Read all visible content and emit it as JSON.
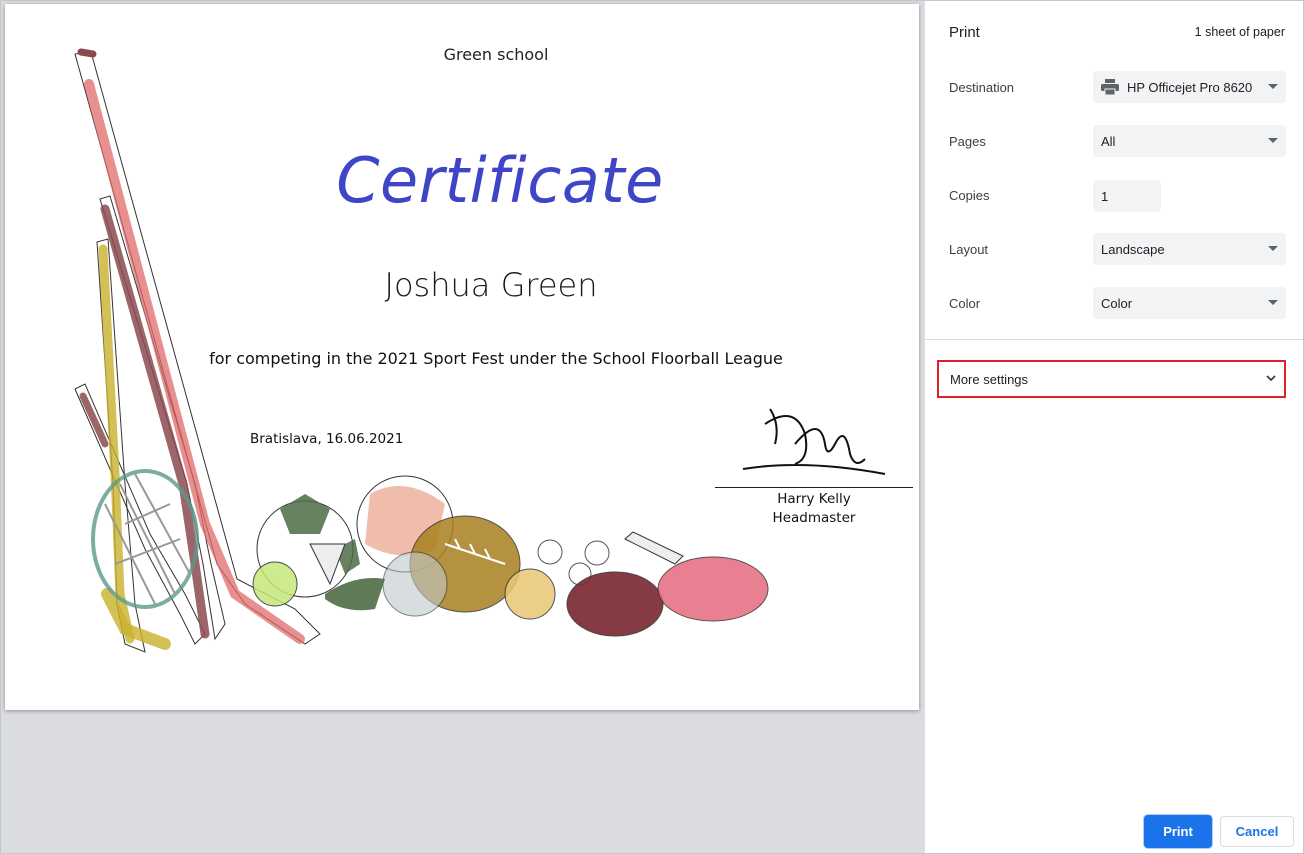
{
  "certificate": {
    "school": "Green school",
    "title": "Certificate",
    "recipient": "Joshua Green",
    "reason": "for competing in the 2021 Sport Fest under the School Floorball League",
    "place_date": "Bratislava, 16.06.2021",
    "signer_name": "Harry Kelly",
    "signer_role": "Headmaster"
  },
  "print_panel": {
    "title": "Print",
    "sheet_count": "1 sheet of paper",
    "destination": {
      "label": "Destination",
      "value": "HP Officejet Pro 8620",
      "icon": "printer-icon"
    },
    "pages": {
      "label": "Pages",
      "value": "All"
    },
    "copies": {
      "label": "Copies",
      "value": "1"
    },
    "layout": {
      "label": "Layout",
      "value": "Landscape"
    },
    "color": {
      "label": "Color",
      "value": "Color"
    },
    "more_settings": {
      "label": "More settings",
      "icon": "chevron-down-icon"
    },
    "print_button": "Print",
    "cancel_button": "Cancel"
  },
  "colors": {
    "accent": "#1a73e8",
    "title_blue": "#3e45c6",
    "highlight_red": "#e0202a",
    "field_bg": "#f1f3f4"
  }
}
